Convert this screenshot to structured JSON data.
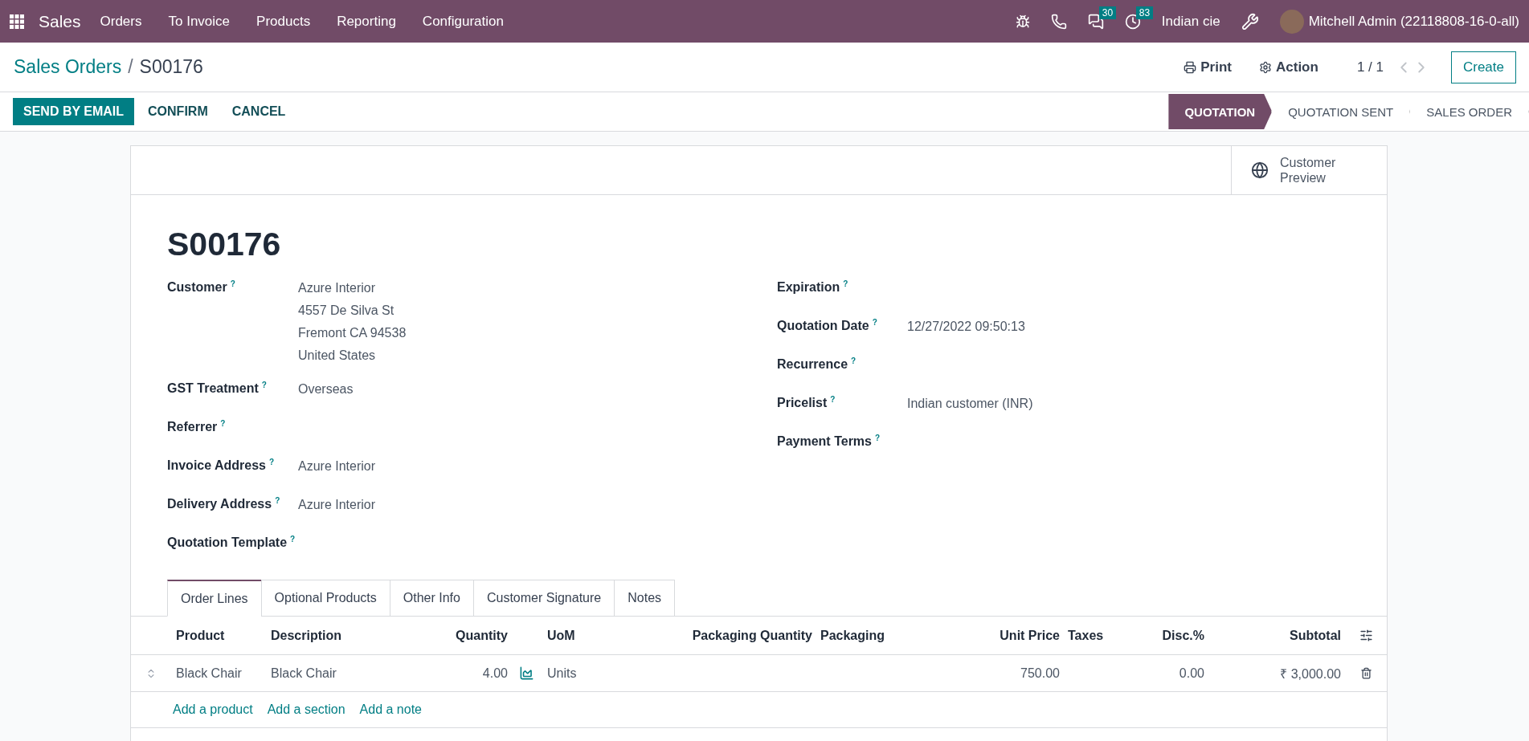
{
  "navbar": {
    "app": "Sales",
    "menu": [
      "Orders",
      "To Invoice",
      "Products",
      "Reporting",
      "Configuration"
    ],
    "messages_count": "30",
    "activities_count": "83",
    "company": "Indian cie",
    "user": "Mitchell Admin (22118808-16-0-all)"
  },
  "control_panel": {
    "breadcrumb": [
      {
        "label": "Sales Orders",
        "kind": "link"
      },
      {
        "label": "S00176",
        "kind": "current"
      }
    ],
    "separator": "/",
    "print": "Print",
    "action": "Action",
    "pager": "1 / 1",
    "create": "Create"
  },
  "buttons": [
    {
      "label": "SEND BY EMAIL",
      "kind": "primary"
    },
    {
      "label": "CONFIRM",
      "kind": "secondary"
    },
    {
      "label": "CANCEL",
      "kind": "secondary"
    }
  ],
  "status_steps": [
    {
      "label": "QUOTATION",
      "selected": true
    },
    {
      "label": "QUOTATION SENT",
      "selected": false
    },
    {
      "label": "SALES ORDER",
      "selected": false
    }
  ],
  "customer_preview": "Customer\nPreview",
  "order_name": "S00176",
  "left_fields": [
    {
      "label": "Customer",
      "help": "?",
      "values": [
        "Azure Interior",
        "4557 De Silva St",
        "Fremont CA 94538",
        "United States"
      ]
    },
    {
      "label": "GST Treatment",
      "help": "?",
      "values": [
        "Overseas"
      ]
    },
    {
      "label": "Referrer",
      "help": "?"
    },
    {
      "label": "Invoice Address",
      "help": "?",
      "values": [
        "Azure Interior"
      ]
    },
    {
      "label": "Delivery Address",
      "help": "?",
      "values": [
        "Azure Interior"
      ]
    },
    {
      "label": "Quotation Template",
      "help": "?"
    }
  ],
  "right_fields": [
    {
      "label": "Expiration",
      "help": "?"
    },
    {
      "label": "Quotation Date",
      "help": "?",
      "values": [
        "12/27/2022 09:50:13"
      ]
    },
    {
      "label": "Recurrence",
      "help": "?"
    },
    {
      "label": "Pricelist",
      "help": "?",
      "values": [
        "Indian customer (INR)"
      ]
    },
    {
      "label": "Payment Terms",
      "help": "?"
    }
  ],
  "tabs": [
    {
      "label": "Order Lines",
      "selected": true
    },
    {
      "label": "Optional Products",
      "selected": false
    },
    {
      "label": "Other Info",
      "selected": false
    },
    {
      "label": "Customer Signature",
      "selected": false
    },
    {
      "label": "Notes",
      "selected": false
    }
  ],
  "table": {
    "columns": [
      "Product",
      "Description",
      "Quantity",
      "UoM",
      "Packaging Quantity",
      "Packaging",
      "Unit Price",
      "Taxes",
      "Disc.%",
      "Subtotal"
    ],
    "rows": [
      {
        "product": "Black Chair",
        "description": "Black Chair",
        "quantity": "4.00",
        "uom": "Units",
        "unit_price": "750.00",
        "discount": "0.00",
        "subtotal": "₹ 3,000.00"
      }
    ],
    "add_links": [
      "Add a product",
      "Add a section",
      "Add a note"
    ]
  }
}
